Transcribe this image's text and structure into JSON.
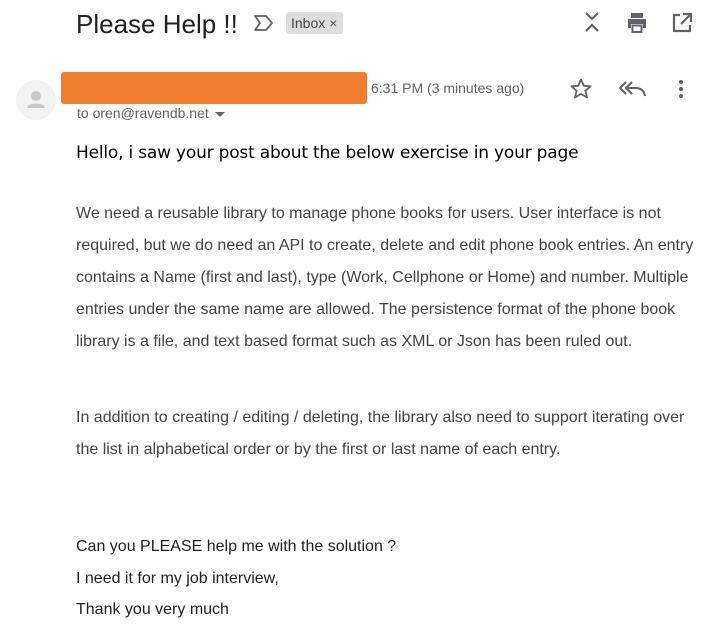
{
  "header": {
    "subject": "Please Help !!",
    "label_chip": "Inbox",
    "label_remove": "×",
    "icons": [
      "important-marker-icon",
      "expand-collapse-icon",
      "print-icon",
      "open-new-window-icon"
    ]
  },
  "message": {
    "sender_redacted": true,
    "timestamp": "6:31 PM (3 minutes ago)",
    "recipient": "to oren@ravendb.net",
    "actions": [
      "star-icon",
      "reply-all-icon",
      "more-vert-icon"
    ]
  },
  "body": {
    "greeting": "Hello, i saw your post about the below exercise in your page",
    "paragraph1": "We need a reusable library to manage phone books for users. User interface is not required, but we do need an API to create, delete and edit phone book entries. An entry contains a Name (first and last), type (Work, Cellphone or Home) and number. Multiple entries under the same name are allowed. The persistence format of the phone book library is a file, and text based format such as XML or Json has been ruled out.",
    "paragraph2": "In addition to creating / editing / deleting, the library also need to support iterating over the list in alphabetical order or by the first or last name of each entry.",
    "closing1": "Can you PLEASE help me with the solution ?",
    "closing2": "I need it for my job interview,",
    "closing3": "Thank you very much"
  },
  "colors": {
    "redaction": "#ef7d2f",
    "chip_bg": "#dddddd",
    "muted_text": "#5f6368",
    "body_text": "#444444"
  }
}
